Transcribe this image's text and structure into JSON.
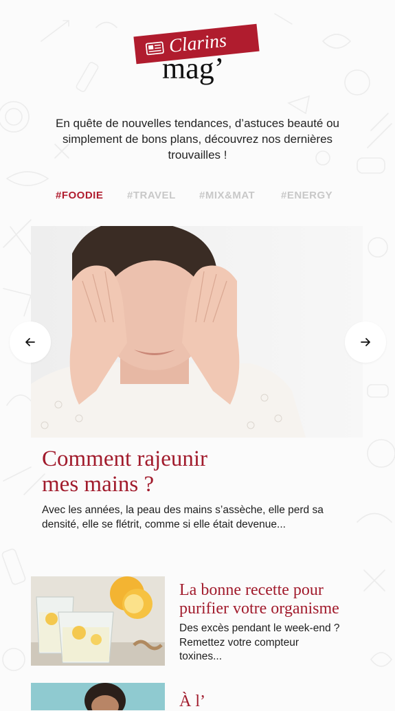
{
  "logo": {
    "brand": "Clarins",
    "mag": "mag’",
    "icon": "newspaper-icon",
    "accent": "#b01c2e"
  },
  "intro": "En quête de nouvelles tendances, d’astuces beauté ou simplement de bons plans, découvrez nos dernières trouvailles !",
  "tabs": [
    {
      "label": "#FOODIE",
      "active": true
    },
    {
      "label": "#TRAVEL",
      "active": false
    },
    {
      "label": "#MIX&MAT",
      "active": false
    },
    {
      "label": "#ENERGY",
      "active": false
    }
  ],
  "carousel": {
    "prev_icon": "arrow-left-icon",
    "next_icon": "arrow-right-icon"
  },
  "hero": {
    "title_line1": "Comment rajeunir",
    "title_line2": "mes mains ?",
    "excerpt": "Avec les années, la peau des mains s’assèche, elle perd sa densité, elle se flétrit, comme si elle était devenue..."
  },
  "articles": [
    {
      "title": "La bonne recette pour purifier votre organisme",
      "excerpt": "Des excès pendant le week-end ? Remettez votre compteur toxines..."
    },
    {
      "title": "À l’"
    }
  ],
  "colors": {
    "accent": "#a11b2c",
    "tab_inactive": "#c8c8c8",
    "background": "#fbfbfb"
  }
}
